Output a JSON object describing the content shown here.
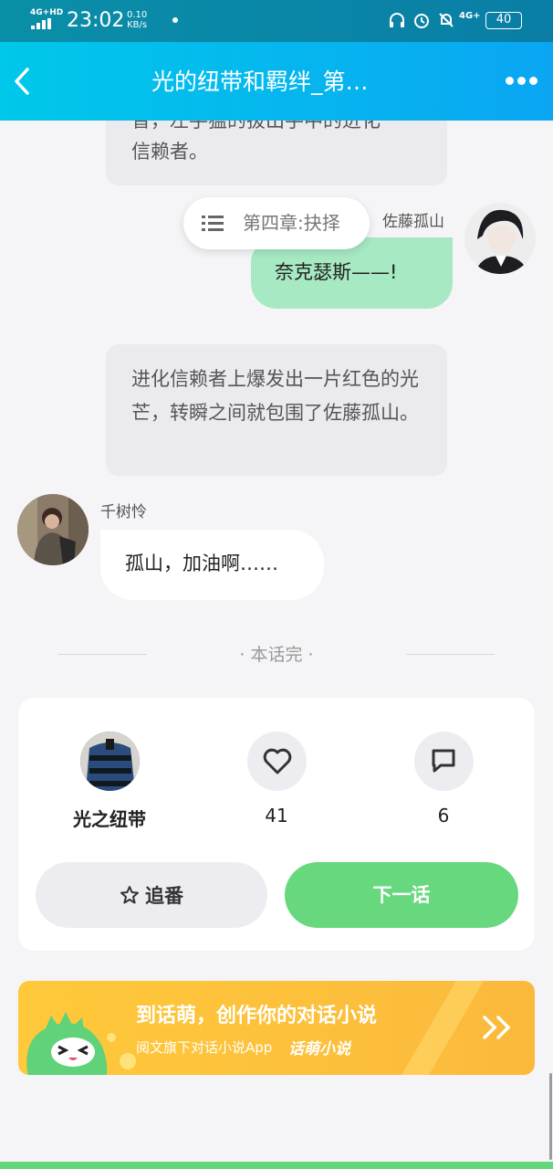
{
  "status_bar": {
    "network": "4G+HD",
    "time": "23:02",
    "speed_value": "0.10",
    "speed_unit": "KB/s",
    "network2": "4G+",
    "battery": "40"
  },
  "header": {
    "title": "光的纽带和羁绊_第…"
  },
  "messages": [
    {
      "type": "narration",
      "text_line1": "普，左手猛的拔出手中的进化",
      "text_line2": "信赖者。"
    },
    {
      "type": "speech",
      "speaker": "佐藤孤山",
      "text": "奈克瑟斯——!"
    },
    {
      "type": "narration",
      "text": "进化信赖者上爆发出一片红色的光芒，转瞬之间就包围了佐藤孤山。"
    },
    {
      "type": "speech",
      "speaker": "千树怜",
      "text": "孤山，加油啊……"
    }
  ],
  "chapter_pill": {
    "label": "第四章:抉择",
    "icon": "menu-list-icon"
  },
  "end_marker": "· 本话完 ·",
  "card": {
    "author": "光之纽带",
    "likes": "41",
    "comments": "6",
    "follow_label": "追番",
    "next_label": "下一话"
  },
  "banner": {
    "title": "到话萌，创作你的对话小说",
    "subtitle": "阅文旗下对话小说App",
    "brand": "话萌小说"
  },
  "colors": {
    "header_start": "#00c8ea",
    "header_end": "#0aa6f2",
    "green_bubble": "#a7e9c3",
    "next_button": "#67d87e",
    "banner": "#ffc93a"
  }
}
